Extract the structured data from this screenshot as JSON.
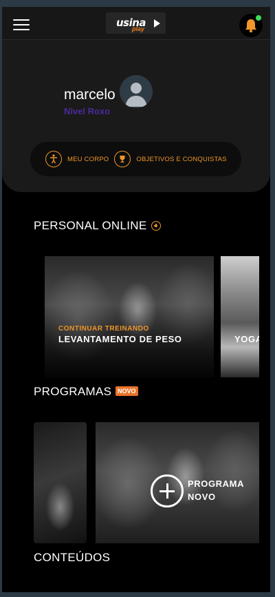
{
  "header": {
    "logo_text": "usina",
    "logo_sub": "play"
  },
  "profile": {
    "name": "marcelo",
    "level": "Nivel Roxo",
    "links": [
      {
        "label": "MEU CORPO",
        "icon": "body-icon"
      },
      {
        "label": "OBJETIVOS E CONQUISTAS",
        "icon": "trophy-icon"
      }
    ]
  },
  "personal": {
    "title": "PERSONAL ONLINE",
    "cards": [
      {
        "kicker": "CONTINUAR TREINANDO",
        "title": "LEVANTAMENTO DE PESO"
      },
      {
        "title": "YOGA"
      }
    ]
  },
  "programas": {
    "title": "PROGRAMAS",
    "badge": "NOVO",
    "new_program_label": "PROGRAMA NOVO"
  },
  "conteudos": {
    "title": "CONTEÚDOS"
  },
  "colors": {
    "accent": "#f0962a",
    "level": "#4b2a9a",
    "notification": "#3ddc5a"
  }
}
